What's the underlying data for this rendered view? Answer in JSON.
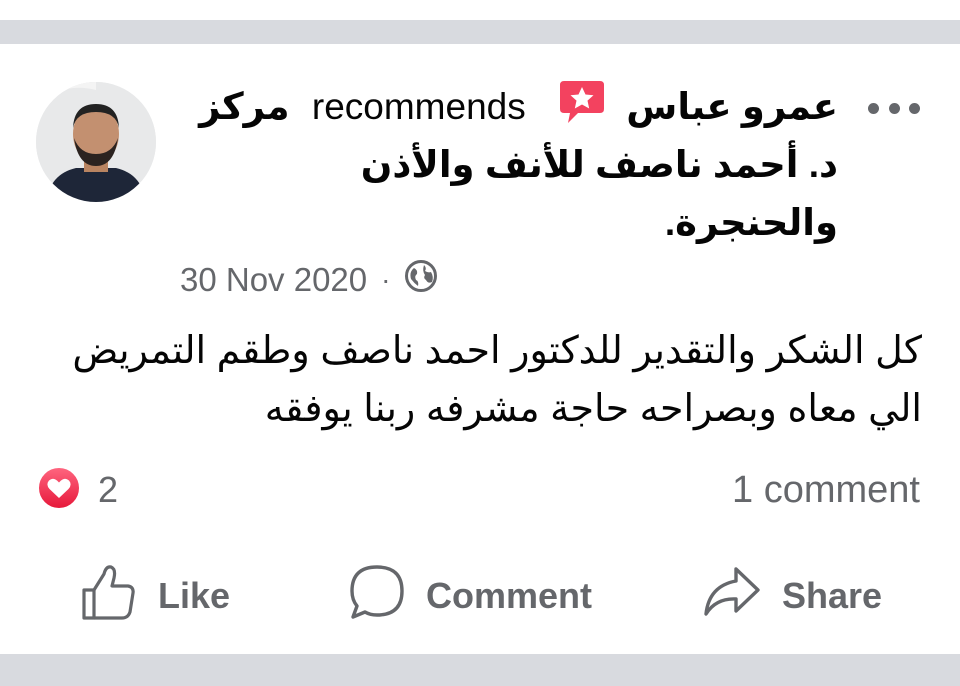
{
  "post": {
    "author": "عمرو عباس",
    "recommends_text": "recommends",
    "target_page": "مركز د. أحمد ناصف للأنف والأذن والحنجرة.",
    "date": "30 Nov 2020",
    "separator": "·",
    "privacy_icon": "globe-icon",
    "body": "كل الشكر والتقدير للدكتور احمد ناصف وطقم التمريض الي معاه وبصراحه حاجة مشرفه ربنا يوفقه",
    "reactions": {
      "icon": "love-reaction-icon",
      "count": "2"
    },
    "comments_count": "1 comment"
  },
  "actions": {
    "like": "Like",
    "comment": "Comment",
    "share": "Share"
  },
  "colors": {
    "divider": "#d8dadf",
    "secondary_text": "#65676b",
    "primary_text": "#050505",
    "love_red": "#f33e58",
    "recommend_badge": "#f3425f"
  }
}
